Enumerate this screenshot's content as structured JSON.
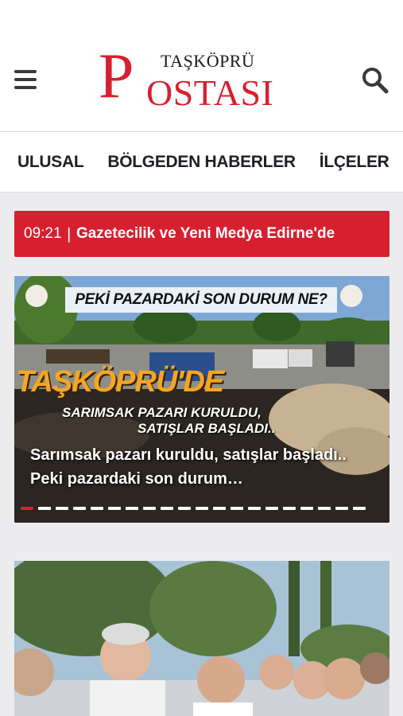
{
  "header": {
    "logo": {
      "top_text": "TAŞKÖPRÜ",
      "main_letter": "P",
      "main_text": "OSTASI"
    },
    "menu_icon": "hamburger-menu-icon",
    "search_icon": "search-icon"
  },
  "nav": {
    "items": [
      "ULUSAL",
      "BÖLGEDEN HABERLER",
      "İLÇELER"
    ]
  },
  "ticker": {
    "time": "09:21",
    "separator": "|",
    "headline": "Gazetecilik ve Yeni Medya Edirne'de"
  },
  "slider": {
    "image_banner": "PEKİ PAZARDAKİ SON DURUM NE?",
    "image_brand": "TAŞKÖPRÜ'DE",
    "image_sub1": "SARIMSAK PAZARI KURULDU,",
    "image_sub2": "SATIŞLAR BAŞLADI..",
    "caption": "Sarımsak pazarı kuruldu, satışlar başladı.. Peki pazardaki son durum…",
    "total_slides": 20,
    "active_slide": 1
  },
  "colors": {
    "brand_red": "#d7202f",
    "background": "#ececef",
    "nav_text": "#1f1f24"
  }
}
